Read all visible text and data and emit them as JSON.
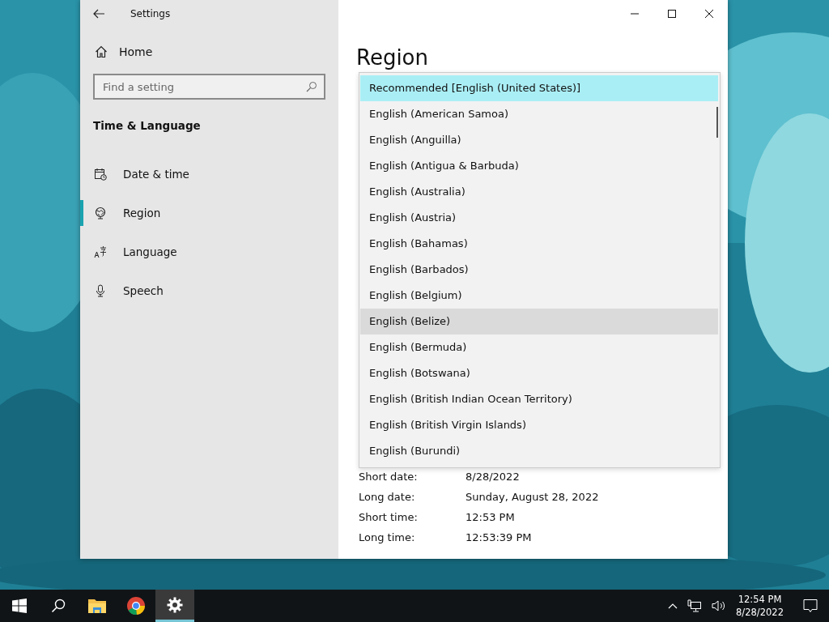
{
  "window": {
    "title": "Settings"
  },
  "sidebar": {
    "home": "Home",
    "search": {
      "placeholder": "Find a setting"
    },
    "section": "Time & Language",
    "items": [
      {
        "label": "Date & time",
        "selected": false
      },
      {
        "label": "Region",
        "selected": true
      },
      {
        "label": "Language",
        "selected": false
      },
      {
        "label": "Speech",
        "selected": false
      }
    ]
  },
  "page": {
    "title": "Region"
  },
  "region_dropdown": {
    "options": [
      {
        "label": "Recommended [English (United States)]",
        "selected": true,
        "hovered": false
      },
      {
        "label": "English (American Samoa)",
        "selected": false,
        "hovered": false
      },
      {
        "label": "English (Anguilla)",
        "selected": false,
        "hovered": false
      },
      {
        "label": "English (Antigua & Barbuda)",
        "selected": false,
        "hovered": false
      },
      {
        "label": "English (Australia)",
        "selected": false,
        "hovered": false
      },
      {
        "label": "English (Austria)",
        "selected": false,
        "hovered": false
      },
      {
        "label": "English (Bahamas)",
        "selected": false,
        "hovered": false
      },
      {
        "label": "English (Barbados)",
        "selected": false,
        "hovered": false
      },
      {
        "label": "English (Belgium)",
        "selected": false,
        "hovered": false
      },
      {
        "label": "English (Belize)",
        "selected": false,
        "hovered": true
      },
      {
        "label": "English (Bermuda)",
        "selected": false,
        "hovered": false
      },
      {
        "label": "English (Botswana)",
        "selected": false,
        "hovered": false
      },
      {
        "label": "English (British Indian Ocean Territory)",
        "selected": false,
        "hovered": false
      },
      {
        "label": "English (British Virgin Islands)",
        "selected": false,
        "hovered": false
      },
      {
        "label": "English (Burundi)",
        "selected": false,
        "hovered": false
      }
    ]
  },
  "formats": [
    {
      "label": "Short date:",
      "value": "8/28/2022"
    },
    {
      "label": "Long date:",
      "value": "Sunday, August 28, 2022"
    },
    {
      "label": "Short time:",
      "value": "12:53 PM"
    },
    {
      "label": "Long time:",
      "value": "12:53:39 PM"
    }
  ],
  "taskbar": {
    "apps": [
      {
        "selected": false
      },
      {
        "selected": false
      },
      {
        "selected": true
      }
    ],
    "time": "12:54 PM",
    "date": "8/28/2022"
  }
}
